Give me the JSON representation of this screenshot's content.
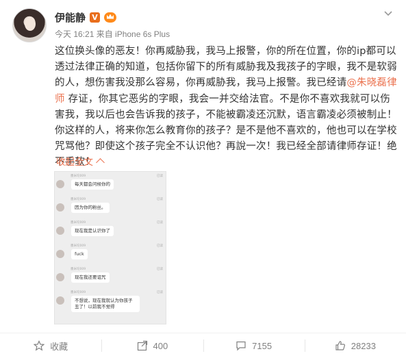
{
  "post": {
    "author": "伊能静",
    "meta": "今天 16:21 来自 iPhone 6s Plus",
    "text_part1": "这位换头像的恶友！你再威胁我，我马上报警，你的所在位置，你的ip都可以透过法律正确的知道，包括你留下的所有威胁我及我孩子的字眼，我不是软弱的人，想伤害我没那么容易，你再威胁我，我马上报警。我已经请",
    "mention": "@朱晓磊律师",
    "text_part2": " 存证，你其它恶劣的字眼，我会一并交给法官。不是你不喜欢我就可以伤害我，我以后也会告诉我的孩子，不能被霸凌还沉默，语言霸凌必须被制止！你这样的人，将来你怎么教育你的孩子？是不是他不喜欢的，他也可以在学校咒骂他？即使这个孩子完全不认识他？再說一次！我已经全部请律师存证！绝不手软！",
    "collapse_label": "收起全文"
  },
  "screenshot": {
    "sender": "墨米坨009",
    "messages": [
      {
        "text": "每天都会问候你的",
        "hint": "已读"
      },
      {
        "text": "因为你的粉丝。",
        "hint": "已读"
      },
      {
        "text": "现在我是认识你了",
        "hint": "已读"
      },
      {
        "text": "fuck",
        "hint": "已读"
      },
      {
        "text": "现在我还要诅咒",
        "hint": "已读"
      },
      {
        "text": "不想说，现在我就认为你孩子丑了！以前我不觉得",
        "hint": "已读"
      }
    ]
  },
  "actions": {
    "favorite": "收藏",
    "repost": "400",
    "comment": "7155",
    "like": "28233"
  },
  "colors": {
    "accent": "#eb7350",
    "text": "#333333",
    "muted": "#808080"
  }
}
